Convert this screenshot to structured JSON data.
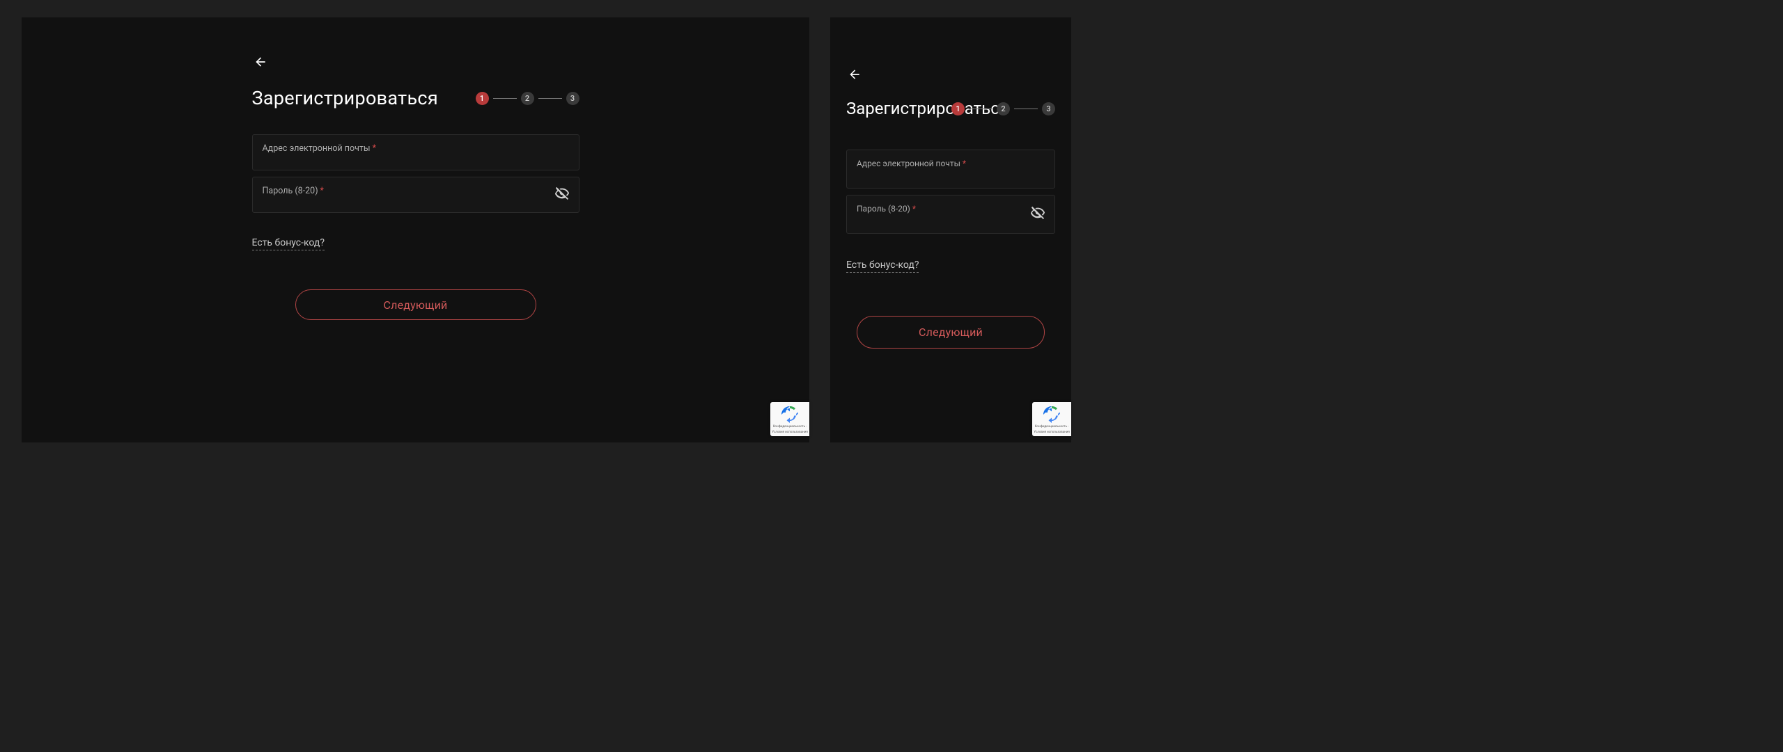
{
  "form": {
    "title": "Зарегистрироваться",
    "email_label": "Адрес электронной почты",
    "password_label": "Пароль (8-20)",
    "required_mark": "*",
    "bonus_link": "Есть бонус-код?",
    "next_label": "Следующий"
  },
  "steps": {
    "s1": "1",
    "s2": "2",
    "s3": "3"
  },
  "recaptcha": {
    "line1": "Конфиденциальность -",
    "line2": "Условия использования"
  }
}
